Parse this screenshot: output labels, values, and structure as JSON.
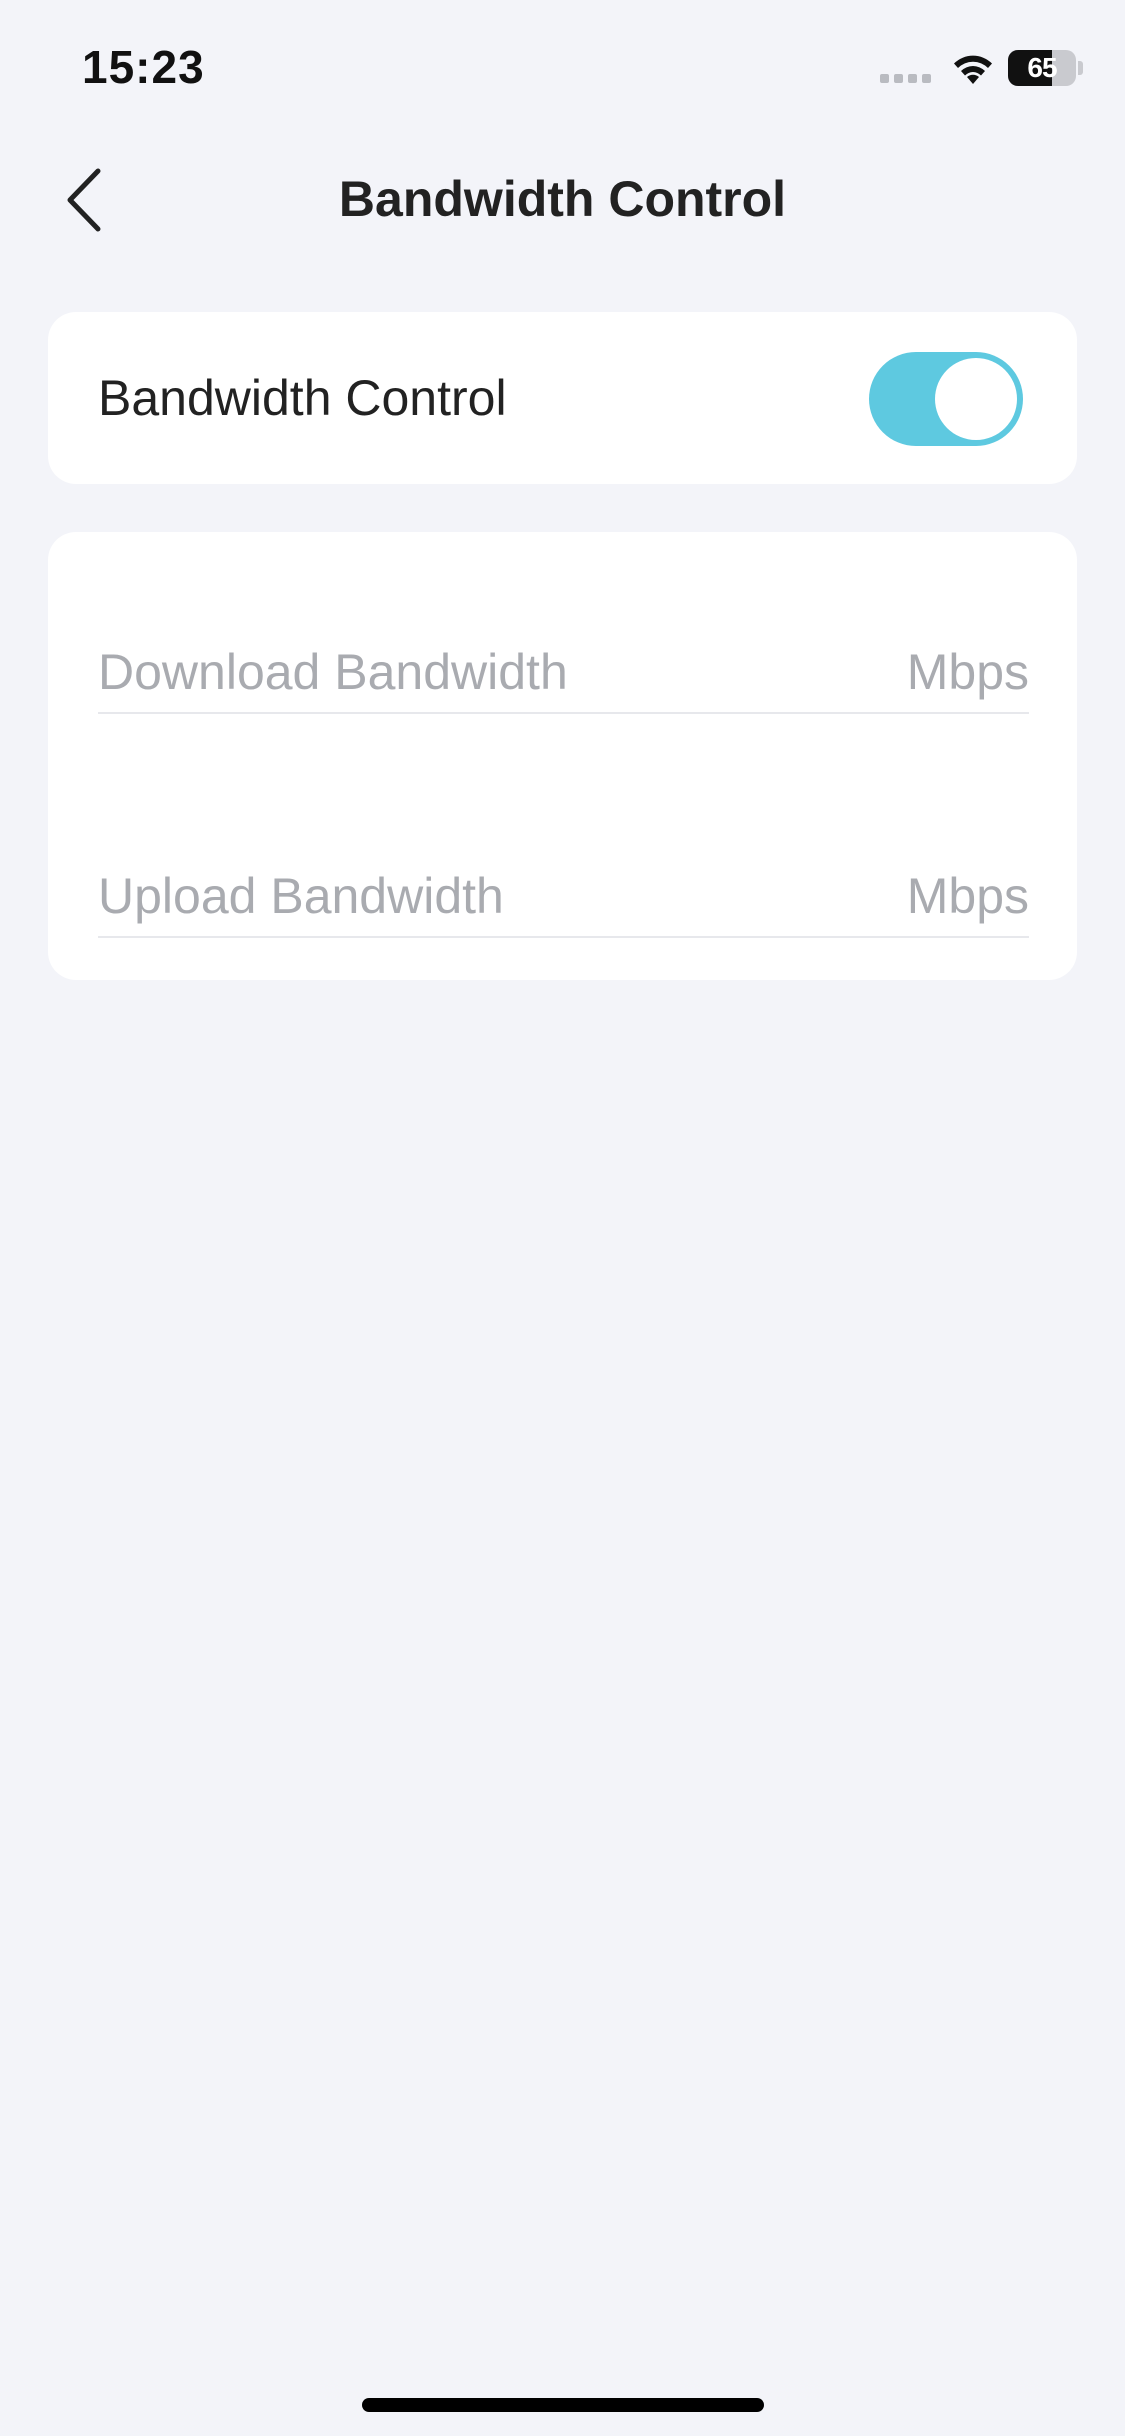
{
  "status_bar": {
    "time": "15:23",
    "battery_level": "65",
    "battery_fraction": 0.65,
    "icons": [
      "signal-dots-icon",
      "wifi-icon",
      "battery-icon"
    ]
  },
  "nav": {
    "title": "Bandwidth Control",
    "back_icon": "chevron-left-icon"
  },
  "toggle_card": {
    "label": "Bandwidth Control",
    "enabled": true,
    "on_color": "#5ec9e0"
  },
  "bandwidth_card": {
    "download": {
      "placeholder": "Download Bandwidth",
      "value": "",
      "unit": "Mbps"
    },
    "upload": {
      "placeholder": "Upload Bandwidth",
      "value": "",
      "unit": "Mbps"
    }
  },
  "colors": {
    "background": "#f3f4f9",
    "card": "#ffffff",
    "accent": "#5ec9e0",
    "placeholder_text": "#a9abb0"
  }
}
